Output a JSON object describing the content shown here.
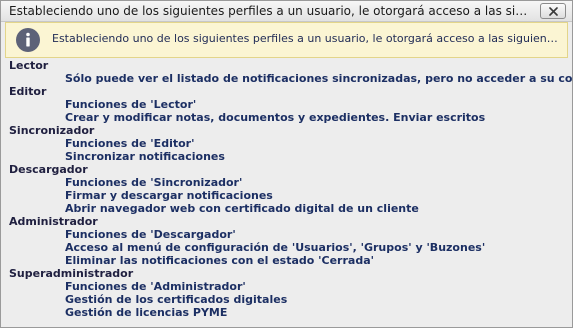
{
  "window": {
    "title": "Estableciendo uno de los siguientes perfiles a un usuario, le otorgará acceso a las siguient..."
  },
  "banner": {
    "text": "Estableciendo uno de los siguientes perfiles a un usuario, le otorgará acceso a las siguientes funcione..."
  },
  "roles": [
    {
      "name": "Lector",
      "items": [
        "Sólo puede ver el listado de notificaciones sincronizadas, pero no acceder a su contenido"
      ]
    },
    {
      "name": "Editor",
      "items": [
        "Funciones de 'Lector'",
        "Crear y modificar notas, documentos y expedientes. Enviar escritos"
      ]
    },
    {
      "name": "Sincronizador",
      "items": [
        "Funciones de 'Editor'",
        "Sincronizar notificaciones"
      ]
    },
    {
      "name": "Descargador",
      "items": [
        "Funciones de 'Sincronizador'",
        "Firmar y descargar notificaciones",
        "Abrir navegador web con certificado digital de un cliente"
      ]
    },
    {
      "name": "Administrador",
      "items": [
        "Funciones de 'Descargador'",
        "Acceso al menú de configuración de 'Usuarios', 'Grupos' y 'Buzones'",
        "Eliminar las notificaciones con el estado 'Cerrada'"
      ]
    },
    {
      "name": "Superadministrador",
      "items": [
        "Funciones de 'Administrador'",
        "Gestión de los certificados digitales",
        "Gestión de licencias PYME"
      ]
    }
  ]
}
